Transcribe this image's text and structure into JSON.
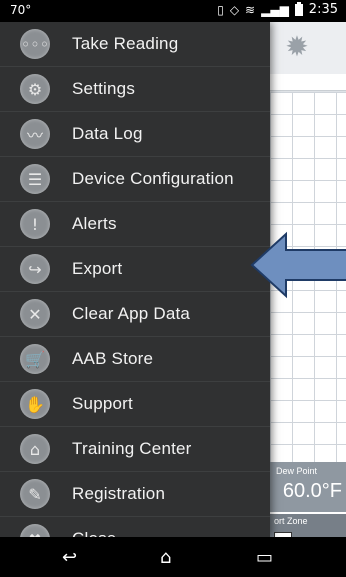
{
  "status_bar": {
    "temperature": "70°",
    "time": "2:35",
    "icons": [
      "vibrate-icon",
      "alarm-icon",
      "wifi-icon",
      "signal-icon",
      "battery-icon"
    ]
  },
  "drawer": {
    "items": [
      {
        "label": "Take Reading",
        "icon": "reading-icon",
        "glyph": "◦◦◦"
      },
      {
        "label": "Settings",
        "icon": "settings-icon",
        "glyph": "⚙"
      },
      {
        "label": "Data Log",
        "icon": "data-log-icon",
        "glyph": "〰"
      },
      {
        "label": "Device Configuration",
        "icon": "device-icon",
        "glyph": "☰"
      },
      {
        "label": "Alerts",
        "icon": "alert-icon",
        "glyph": "!"
      },
      {
        "label": "Export",
        "icon": "export-icon",
        "glyph": "↪"
      },
      {
        "label": "Clear App Data",
        "icon": "clear-data-icon",
        "glyph": "✕"
      },
      {
        "label": "AAB Store",
        "icon": "cart-icon",
        "glyph": "🛒"
      },
      {
        "label": "Support",
        "icon": "support-icon",
        "glyph": "✋"
      },
      {
        "label": "Training Center",
        "icon": "training-icon",
        "glyph": "⌂"
      },
      {
        "label": "Registration",
        "icon": "registration-icon",
        "glyph": "✎"
      },
      {
        "label": "Close",
        "icon": "close-icon",
        "glyph": "✖"
      }
    ]
  },
  "background_app": {
    "dew_point_title": "Dew Point",
    "dew_point_value": "60.0°F",
    "comfort_zone_label": "ort Zone"
  },
  "colors": {
    "drawer_bg": "#303132",
    "arrow_fill": "#6e8fbf"
  },
  "nav_bar": {
    "back_icon": "back-icon",
    "home_icon": "home-icon",
    "recent_icon": "recent-apps-icon"
  }
}
